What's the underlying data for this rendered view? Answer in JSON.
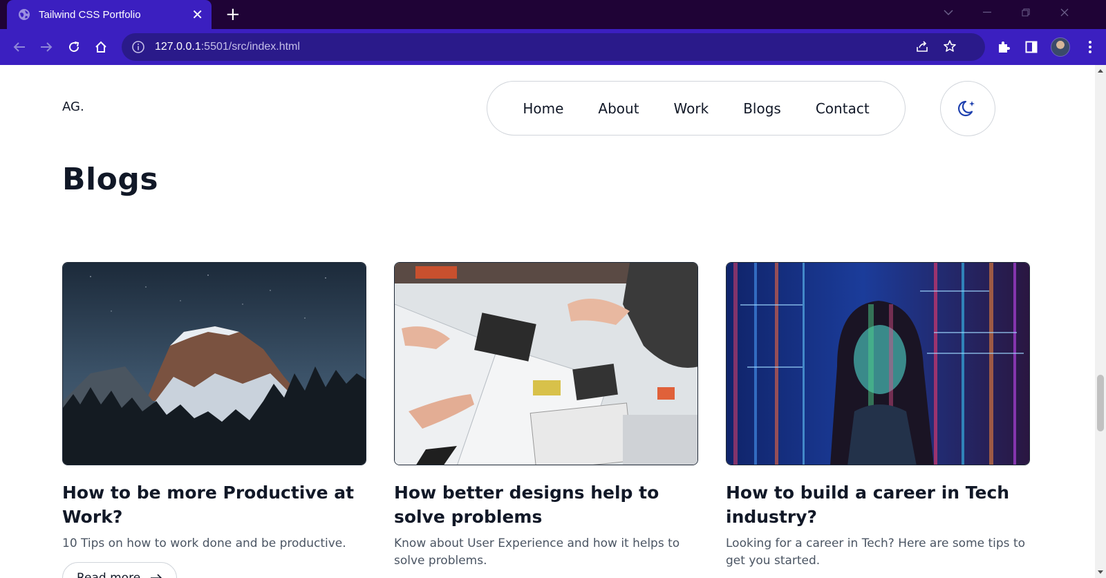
{
  "browser": {
    "tab_title": "Tailwind CSS Portfolio",
    "tab_close": "✕",
    "new_tab": "+",
    "url_host": "127.0.0.1",
    "url_rest": ":5501/src/index.html"
  },
  "header": {
    "logo": "AG.",
    "nav": [
      "Home",
      "About",
      "Work",
      "Blogs",
      "Contact"
    ]
  },
  "section": {
    "title": "Blogs"
  },
  "blogs": [
    {
      "title": "How to be more Productive at Work?",
      "description": "10 Tips on how to work done and be productive.",
      "image": "mountain-night-photo",
      "button": "Read more"
    },
    {
      "title": "How better designs help to solve problems",
      "description": "Know about User Experience and how it helps to solve problems.",
      "image": "design-workshop-photo"
    },
    {
      "title": "How to build a career in Tech industry?",
      "description": "Looking for a career in Tech? Here are some tips to get you started.",
      "image": "tech-projection-photo"
    }
  ],
  "colors": {
    "tabbar": "#1f0336",
    "toolbar": "#3b1fc0",
    "text": "#111827",
    "muted": "#4b5563",
    "accent": "#1e40af"
  }
}
